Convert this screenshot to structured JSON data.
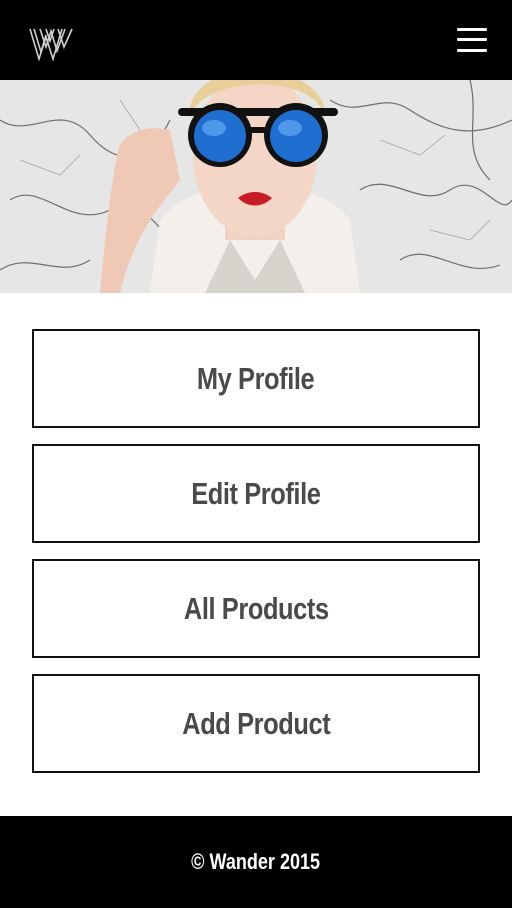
{
  "header": {
    "logo_icon": "w-logo-icon",
    "menu_icon": "hamburger-menu-icon"
  },
  "hero": {
    "image": "woman-blue-sunglasses-marble-background"
  },
  "menu": {
    "items": [
      {
        "label": "My Profile"
      },
      {
        "label": "Edit Profile"
      },
      {
        "label": "All Products"
      },
      {
        "label": "Add Product"
      }
    ]
  },
  "footer": {
    "copyright": "© Wander 2015"
  },
  "colors": {
    "header_bg": "#000000",
    "footer_bg": "#000000",
    "button_border": "#111111",
    "button_text": "#4a4a4a"
  }
}
